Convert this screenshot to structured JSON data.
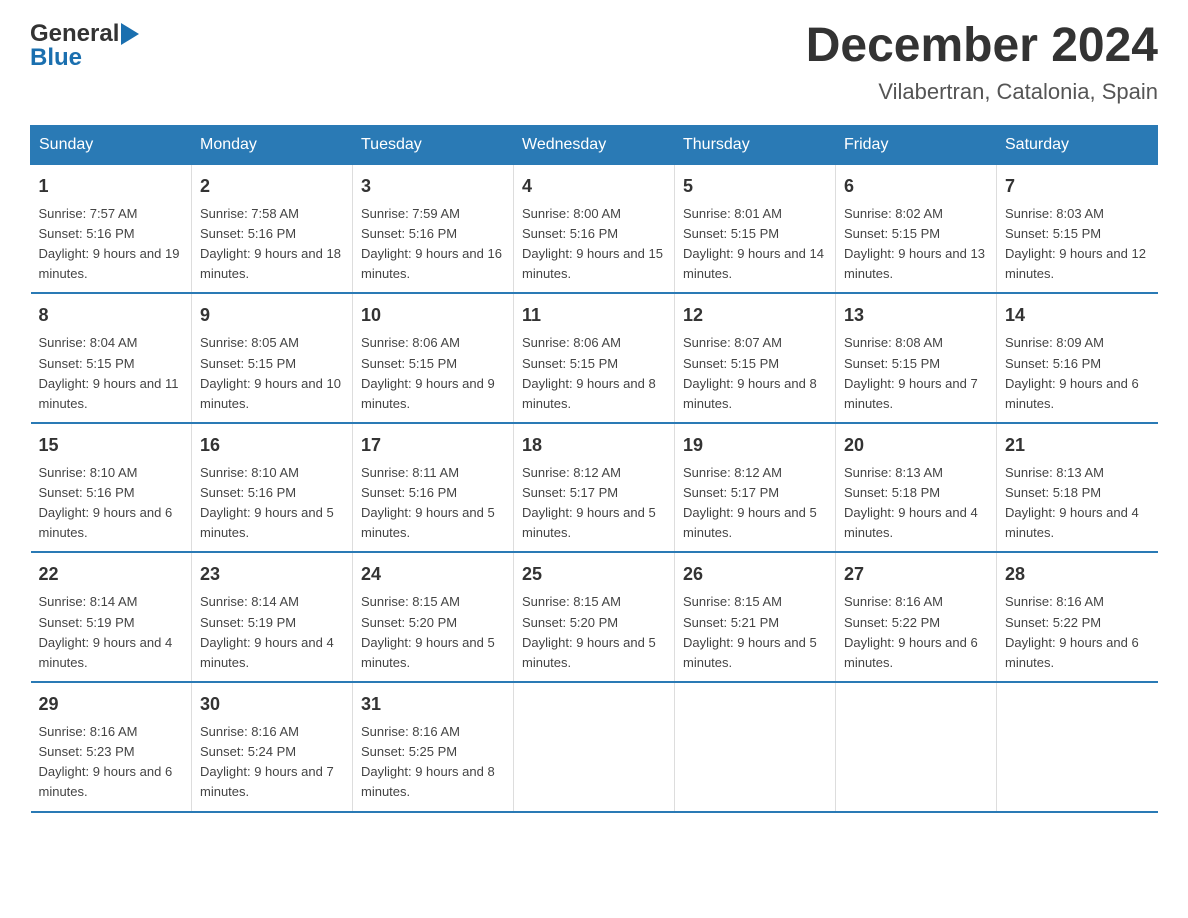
{
  "logo": {
    "line1": "General",
    "line2": "Blue",
    "arrow": "▶"
  },
  "title": "December 2024",
  "subtitle": "Vilabertran, Catalonia, Spain",
  "weekdays": [
    "Sunday",
    "Monday",
    "Tuesday",
    "Wednesday",
    "Thursday",
    "Friday",
    "Saturday"
  ],
  "weeks": [
    [
      {
        "day": "1",
        "sunrise": "Sunrise: 7:57 AM",
        "sunset": "Sunset: 5:16 PM",
        "daylight": "Daylight: 9 hours and 19 minutes."
      },
      {
        "day": "2",
        "sunrise": "Sunrise: 7:58 AM",
        "sunset": "Sunset: 5:16 PM",
        "daylight": "Daylight: 9 hours and 18 minutes."
      },
      {
        "day": "3",
        "sunrise": "Sunrise: 7:59 AM",
        "sunset": "Sunset: 5:16 PM",
        "daylight": "Daylight: 9 hours and 16 minutes."
      },
      {
        "day": "4",
        "sunrise": "Sunrise: 8:00 AM",
        "sunset": "Sunset: 5:16 PM",
        "daylight": "Daylight: 9 hours and 15 minutes."
      },
      {
        "day": "5",
        "sunrise": "Sunrise: 8:01 AM",
        "sunset": "Sunset: 5:15 PM",
        "daylight": "Daylight: 9 hours and 14 minutes."
      },
      {
        "day": "6",
        "sunrise": "Sunrise: 8:02 AM",
        "sunset": "Sunset: 5:15 PM",
        "daylight": "Daylight: 9 hours and 13 minutes."
      },
      {
        "day": "7",
        "sunrise": "Sunrise: 8:03 AM",
        "sunset": "Sunset: 5:15 PM",
        "daylight": "Daylight: 9 hours and 12 minutes."
      }
    ],
    [
      {
        "day": "8",
        "sunrise": "Sunrise: 8:04 AM",
        "sunset": "Sunset: 5:15 PM",
        "daylight": "Daylight: 9 hours and 11 minutes."
      },
      {
        "day": "9",
        "sunrise": "Sunrise: 8:05 AM",
        "sunset": "Sunset: 5:15 PM",
        "daylight": "Daylight: 9 hours and 10 minutes."
      },
      {
        "day": "10",
        "sunrise": "Sunrise: 8:06 AM",
        "sunset": "Sunset: 5:15 PM",
        "daylight": "Daylight: 9 hours and 9 minutes."
      },
      {
        "day": "11",
        "sunrise": "Sunrise: 8:06 AM",
        "sunset": "Sunset: 5:15 PM",
        "daylight": "Daylight: 9 hours and 8 minutes."
      },
      {
        "day": "12",
        "sunrise": "Sunrise: 8:07 AM",
        "sunset": "Sunset: 5:15 PM",
        "daylight": "Daylight: 9 hours and 8 minutes."
      },
      {
        "day": "13",
        "sunrise": "Sunrise: 8:08 AM",
        "sunset": "Sunset: 5:15 PM",
        "daylight": "Daylight: 9 hours and 7 minutes."
      },
      {
        "day": "14",
        "sunrise": "Sunrise: 8:09 AM",
        "sunset": "Sunset: 5:16 PM",
        "daylight": "Daylight: 9 hours and 6 minutes."
      }
    ],
    [
      {
        "day": "15",
        "sunrise": "Sunrise: 8:10 AM",
        "sunset": "Sunset: 5:16 PM",
        "daylight": "Daylight: 9 hours and 6 minutes."
      },
      {
        "day": "16",
        "sunrise": "Sunrise: 8:10 AM",
        "sunset": "Sunset: 5:16 PM",
        "daylight": "Daylight: 9 hours and 5 minutes."
      },
      {
        "day": "17",
        "sunrise": "Sunrise: 8:11 AM",
        "sunset": "Sunset: 5:16 PM",
        "daylight": "Daylight: 9 hours and 5 minutes."
      },
      {
        "day": "18",
        "sunrise": "Sunrise: 8:12 AM",
        "sunset": "Sunset: 5:17 PM",
        "daylight": "Daylight: 9 hours and 5 minutes."
      },
      {
        "day": "19",
        "sunrise": "Sunrise: 8:12 AM",
        "sunset": "Sunset: 5:17 PM",
        "daylight": "Daylight: 9 hours and 5 minutes."
      },
      {
        "day": "20",
        "sunrise": "Sunrise: 8:13 AM",
        "sunset": "Sunset: 5:18 PM",
        "daylight": "Daylight: 9 hours and 4 minutes."
      },
      {
        "day": "21",
        "sunrise": "Sunrise: 8:13 AM",
        "sunset": "Sunset: 5:18 PM",
        "daylight": "Daylight: 9 hours and 4 minutes."
      }
    ],
    [
      {
        "day": "22",
        "sunrise": "Sunrise: 8:14 AM",
        "sunset": "Sunset: 5:19 PM",
        "daylight": "Daylight: 9 hours and 4 minutes."
      },
      {
        "day": "23",
        "sunrise": "Sunrise: 8:14 AM",
        "sunset": "Sunset: 5:19 PM",
        "daylight": "Daylight: 9 hours and 4 minutes."
      },
      {
        "day": "24",
        "sunrise": "Sunrise: 8:15 AM",
        "sunset": "Sunset: 5:20 PM",
        "daylight": "Daylight: 9 hours and 5 minutes."
      },
      {
        "day": "25",
        "sunrise": "Sunrise: 8:15 AM",
        "sunset": "Sunset: 5:20 PM",
        "daylight": "Daylight: 9 hours and 5 minutes."
      },
      {
        "day": "26",
        "sunrise": "Sunrise: 8:15 AM",
        "sunset": "Sunset: 5:21 PM",
        "daylight": "Daylight: 9 hours and 5 minutes."
      },
      {
        "day": "27",
        "sunrise": "Sunrise: 8:16 AM",
        "sunset": "Sunset: 5:22 PM",
        "daylight": "Daylight: 9 hours and 6 minutes."
      },
      {
        "day": "28",
        "sunrise": "Sunrise: 8:16 AM",
        "sunset": "Sunset: 5:22 PM",
        "daylight": "Daylight: 9 hours and 6 minutes."
      }
    ],
    [
      {
        "day": "29",
        "sunrise": "Sunrise: 8:16 AM",
        "sunset": "Sunset: 5:23 PM",
        "daylight": "Daylight: 9 hours and 6 minutes."
      },
      {
        "day": "30",
        "sunrise": "Sunrise: 8:16 AM",
        "sunset": "Sunset: 5:24 PM",
        "daylight": "Daylight: 9 hours and 7 minutes."
      },
      {
        "day": "31",
        "sunrise": "Sunrise: 8:16 AM",
        "sunset": "Sunset: 5:25 PM",
        "daylight": "Daylight: 9 hours and 8 minutes."
      },
      null,
      null,
      null,
      null
    ]
  ]
}
